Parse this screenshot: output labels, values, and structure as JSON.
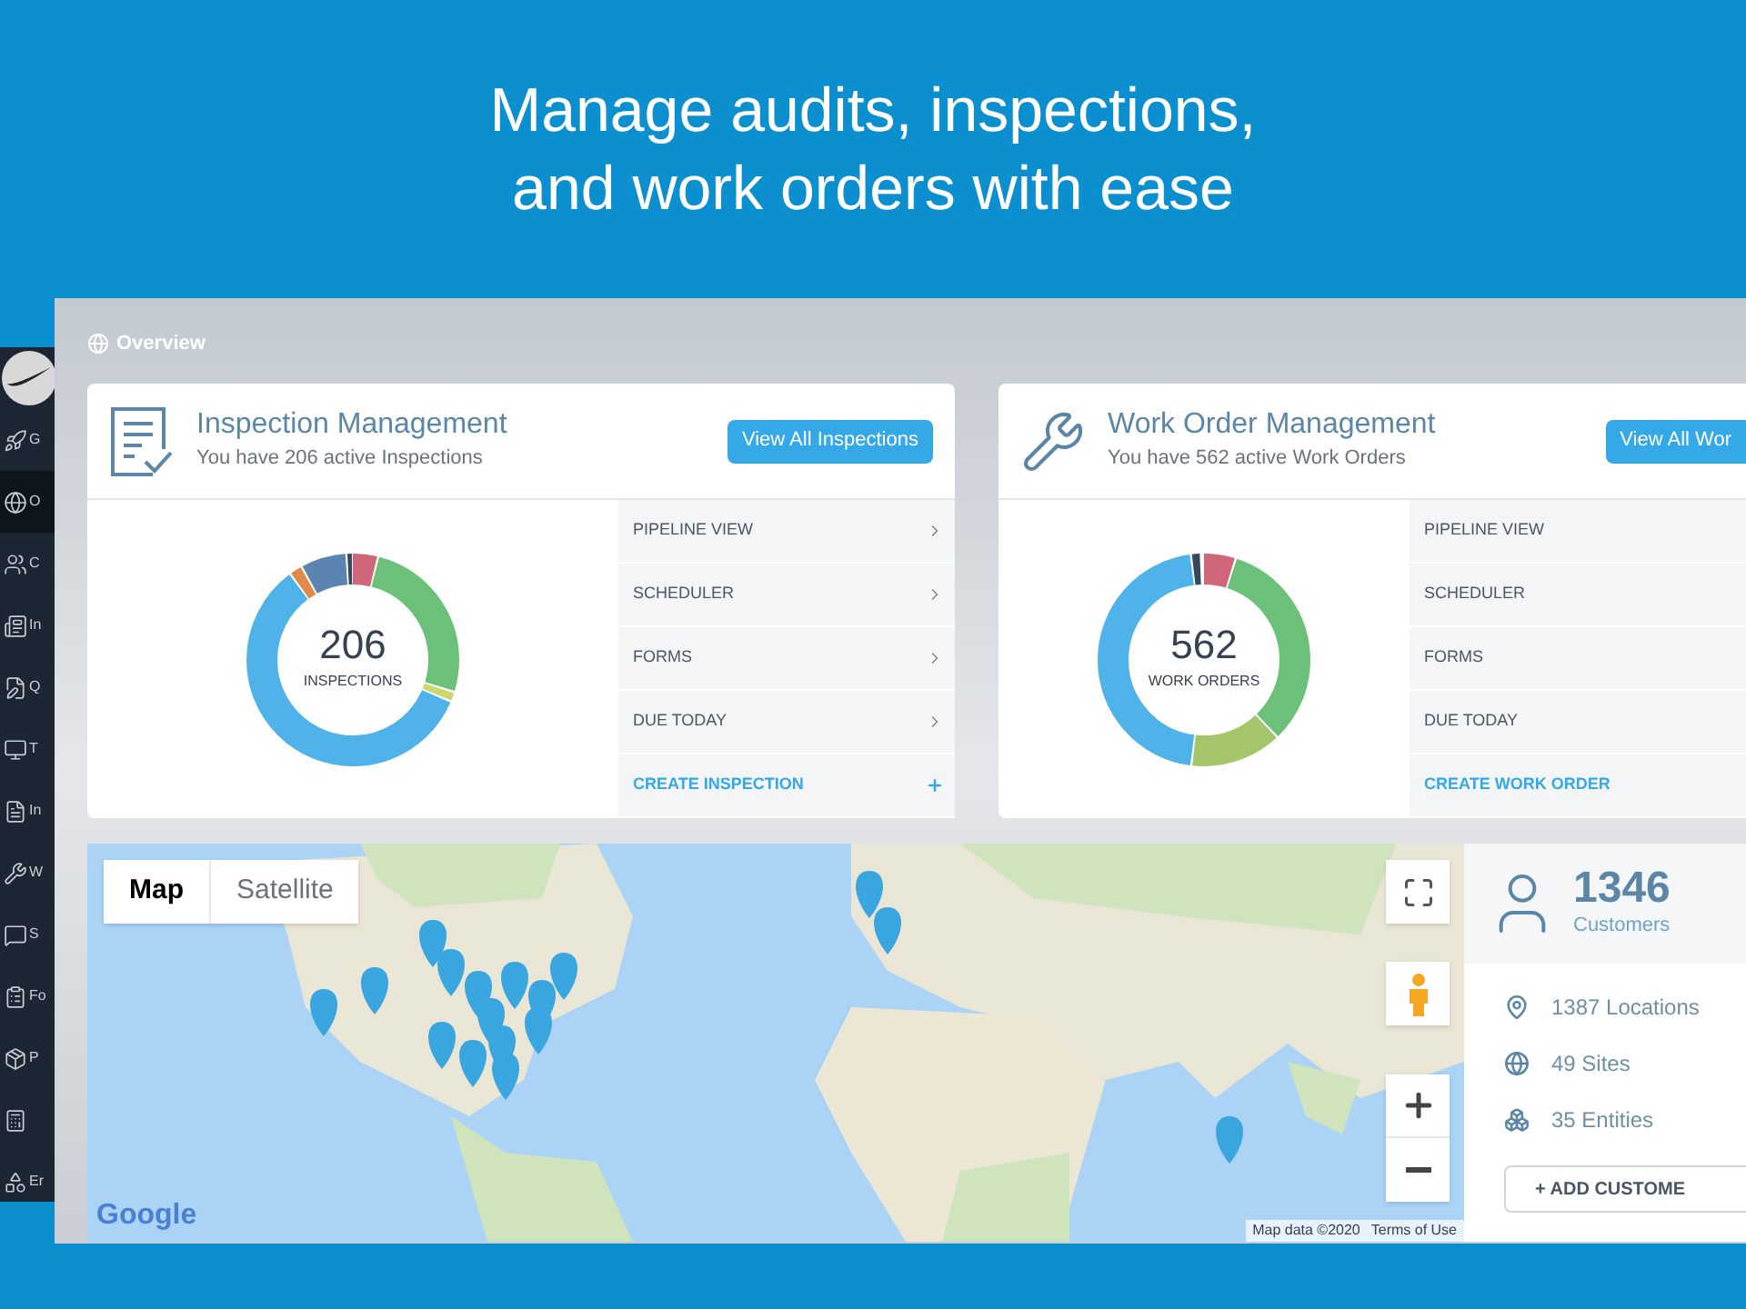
{
  "headline": [
    "Manage audits, inspections,",
    "and work orders with ease"
  ],
  "sidebar": {
    "items": [
      {
        "label": "G",
        "selected": false
      },
      {
        "label": "O",
        "selected": true
      },
      {
        "label": "C",
        "selected": false
      },
      {
        "label": "In",
        "selected": false
      },
      {
        "label": "Q",
        "selected": false
      },
      {
        "label": "T",
        "selected": false
      },
      {
        "label": "In",
        "selected": false
      },
      {
        "label": "W",
        "selected": false
      },
      {
        "label": "S",
        "selected": false
      },
      {
        "label": "Fo",
        "selected": false
      },
      {
        "label": "P",
        "selected": false
      },
      {
        "selected": false
      },
      {
        "label": "Er",
        "selected": false
      }
    ]
  },
  "page_title": "Overview",
  "cards": [
    {
      "kind": "inspection",
      "title": "Inspection Management",
      "subtitle": "You have 206 active Inspections",
      "button": "View All Inspections",
      "count": "206",
      "count_label": "INSPECTIONS",
      "cut_off": false,
      "menu": [
        {
          "kind": "nav",
          "label": "PIPELINE VIEW"
        },
        {
          "kind": "nav",
          "label": "SCHEDULER"
        },
        {
          "kind": "nav",
          "label": "FORMS"
        },
        {
          "kind": "nav",
          "label": "DUE TODAY"
        },
        {
          "kind": "create",
          "label": "CREATE INSPECTION"
        }
      ]
    },
    {
      "kind": "work_order",
      "title": "Work Order Management",
      "subtitle": "You have 562 active Work Orders",
      "button": "View All Wor",
      "count": "562",
      "count_label": "WORK ORDERS",
      "cut_off": true,
      "menu": [
        {
          "kind": "nav",
          "label": "PIPELINE VIEW"
        },
        {
          "kind": "nav",
          "label": "SCHEDULER"
        },
        {
          "kind": "nav",
          "label": "FORMS"
        },
        {
          "kind": "nav",
          "label": "DUE TODAY"
        },
        {
          "kind": "create",
          "label": "CREATE WORK ORDER"
        }
      ]
    }
  ],
  "map": {
    "tabs": [
      {
        "label": "Map",
        "selected": true
      },
      {
        "label": "Satellite",
        "selected": false
      }
    ],
    "logo": "Google",
    "attribution": "Map data ©2020",
    "terms": "Terms of Use"
  },
  "customers": {
    "count": "1346",
    "label": "Customers",
    "stats": [
      {
        "kind": "location",
        "text": "1387 Locations"
      },
      {
        "kind": "site",
        "text": "49 Sites"
      },
      {
        "kind": "entity",
        "text": "35 Entities"
      }
    ],
    "button": "+ ADD CUSTOME"
  }
}
